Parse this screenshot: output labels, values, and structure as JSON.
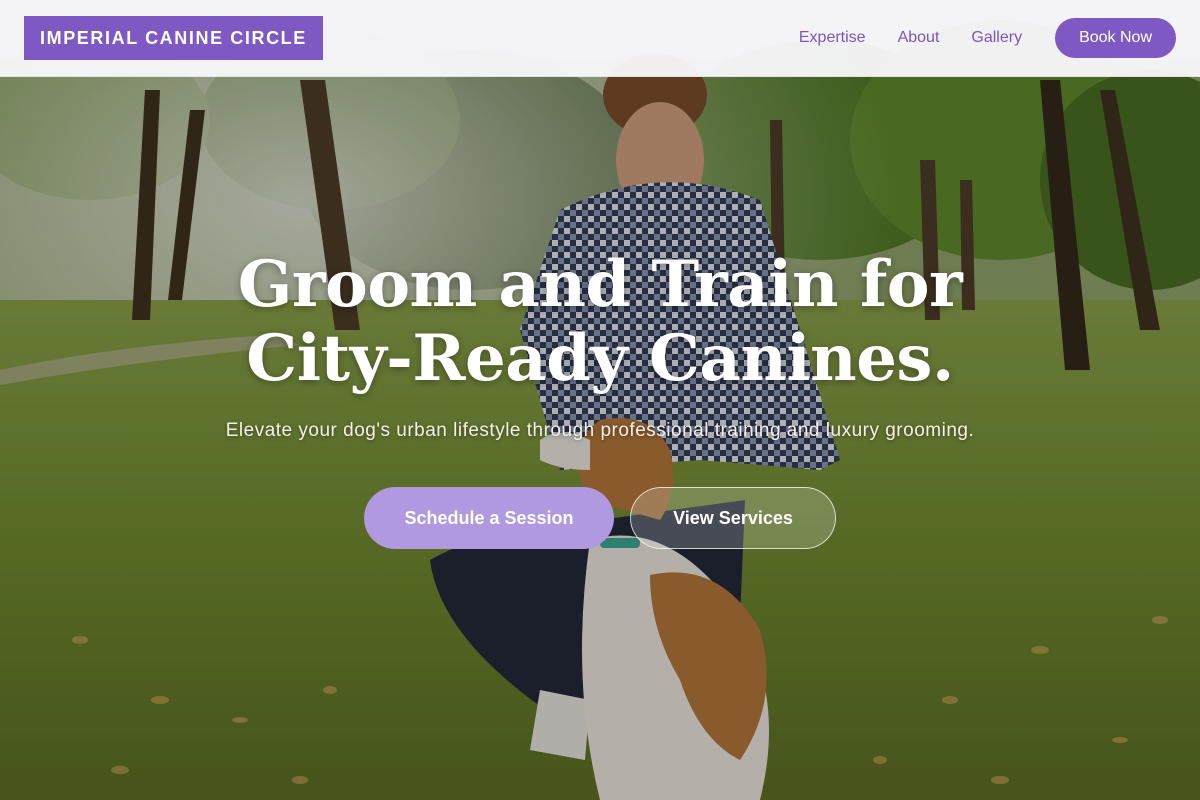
{
  "header": {
    "logo_text": "IMPERIAL CANINE CIRCLE",
    "nav": [
      {
        "label": "Expertise"
      },
      {
        "label": "About"
      },
      {
        "label": "Gallery"
      }
    ],
    "book_label": "Book Now"
  },
  "hero": {
    "headline_line1": "Groom and Train for",
    "headline_line2": "City-Ready Canines.",
    "subheadline": "Elevate your dog's urban lifestyle through professional training and luxury grooming.",
    "primary_cta": "Schedule a Session",
    "secondary_cta": "View Services"
  },
  "colors": {
    "brand_purple": "#7e58c3",
    "nav_text": "#7b55bd",
    "primary_cta_bg": "#b099e0"
  }
}
